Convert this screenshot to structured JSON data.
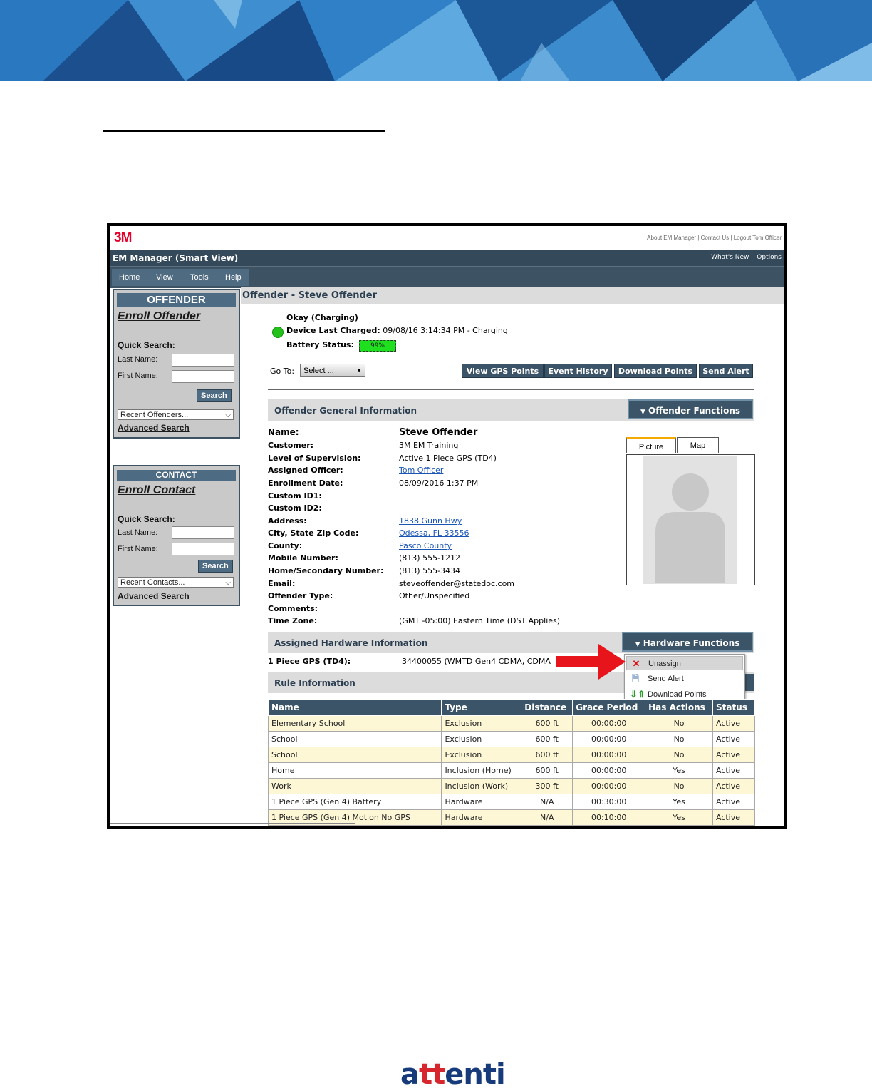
{
  "app": {
    "logo": "3M",
    "top_links": "About EM Manager | Contact Us | Logout Tom Officer",
    "title": "EM Manager (Smart View)",
    "whats_new": "What's New",
    "options": "Options",
    "menu": [
      "Home",
      "View",
      "Tools",
      "Help"
    ]
  },
  "sidebar": {
    "offender": {
      "header": "OFFENDER",
      "enroll": "Enroll Offender",
      "quick_search": "Quick Search:",
      "last_name": "Last Name:",
      "first_name": "First Name:",
      "search": "Search",
      "recent": "Recent Offenders...",
      "advanced": "Advanced Search"
    },
    "contact": {
      "header": "CONTACT",
      "enroll": "Enroll Contact",
      "quick_search": "Quick Search:",
      "last_name": "Last Name:",
      "first_name": "First Name:",
      "search": "Search",
      "recent": "Recent Contacts...",
      "advanced": "Advanced Search"
    }
  },
  "page": {
    "title": "Offender - Steve Offender",
    "status": {
      "state": "Okay (Charging)",
      "last_charged_label": "Device Last Charged:",
      "last_charged_value": "09/08/16 3:14:34 PM - Charging",
      "battery_label": "Battery Status:",
      "battery_value": "99%",
      "battery_level": 0.99
    },
    "goto_label": "Go To:",
    "goto_select": "Select ...",
    "actions": [
      "View GPS Points",
      "Event History",
      "Download Points",
      "Send Alert"
    ],
    "general_section": "Offender General Information",
    "offender_functions": "Offender Functions",
    "info": [
      {
        "label": "Name:",
        "value": "Steve Offender"
      },
      {
        "label": "Customer:",
        "value": "3M EM Training"
      },
      {
        "label": "Level of Supervision:",
        "value": "Active 1 Piece GPS (TD4)"
      },
      {
        "label": "Assigned Officer:",
        "value": "Tom Officer"
      },
      {
        "label": "Enrollment Date:",
        "value": "08/09/2016 1:37 PM"
      },
      {
        "label": "Custom ID1:",
        "value": ""
      },
      {
        "label": "Custom ID2:",
        "value": ""
      },
      {
        "label": "Address:",
        "value": "1838 Gunn Hwy"
      },
      {
        "label": "City, State Zip Code:",
        "value": "Odessa, FL 33556"
      },
      {
        "label": "County:",
        "value": "Pasco County"
      },
      {
        "label": "Mobile Number:",
        "value": "(813) 555-1212"
      },
      {
        "label": "Home/Secondary Number:",
        "value": "(813) 555-3434"
      },
      {
        "label": "Email:",
        "value": "steveoffender@statedoc.com"
      },
      {
        "label": "Offender Type:",
        "value": "Other/Unspecified"
      },
      {
        "label": "Comments:",
        "value": ""
      },
      {
        "label": "Time Zone:",
        "value": "(GMT -05:00) Eastern Time (DST Applies)"
      }
    ],
    "tabs": [
      "Picture",
      "Map"
    ],
    "hardware_section": "Assigned Hardware Information",
    "hardware_functions": "Hardware Functions",
    "hardware_label": "1 Piece GPS (TD4):",
    "hardware_value": "34400055 (WMTD Gen4 CDMA, CDMA",
    "hardware_menu": [
      "Unassign",
      "Send Alert",
      "Download Points"
    ],
    "rule_section": "Rule Information",
    "rules": {
      "columns": [
        "Name",
        "Type",
        "Distance",
        "Grace Period",
        "Has Actions",
        "Status"
      ],
      "rows": [
        [
          "Elementary School",
          "Exclusion",
          "600 ft",
          "00:00:00",
          "No",
          "Active"
        ],
        [
          "School",
          "Exclusion",
          "600 ft",
          "00:00:00",
          "No",
          "Active"
        ],
        [
          "School",
          "Exclusion",
          "600 ft",
          "00:00:00",
          "No",
          "Active"
        ],
        [
          "Home",
          "Inclusion (Home)",
          "600 ft",
          "00:00:00",
          "Yes",
          "Active"
        ],
        [
          "Work",
          "Inclusion (Work)",
          "300 ft",
          "00:00:00",
          "No",
          "Active"
        ],
        [
          "1 Piece GPS (Gen 4) Battery",
          "Hardware",
          "N/A",
          "00:30:00",
          "Yes",
          "Active"
        ],
        [
          "1 Piece GPS (Gen 4) Motion No GPS",
          "Hardware",
          "N/A",
          "00:10:00",
          "Yes",
          "Active"
        ]
      ]
    }
  },
  "footer": {
    "brand_prefix": "a",
    "brand_highlight": "tt",
    "brand_suffix": "enti"
  },
  "colors": {
    "header_bg": "#34495a",
    "button_bg": "#3c5467",
    "row_highlight": "#fdf7d6",
    "link": "#1a55b5",
    "brand_red": "#d7262e",
    "brand_blue": "#173b7a",
    "arrow": "#e8141c"
  }
}
